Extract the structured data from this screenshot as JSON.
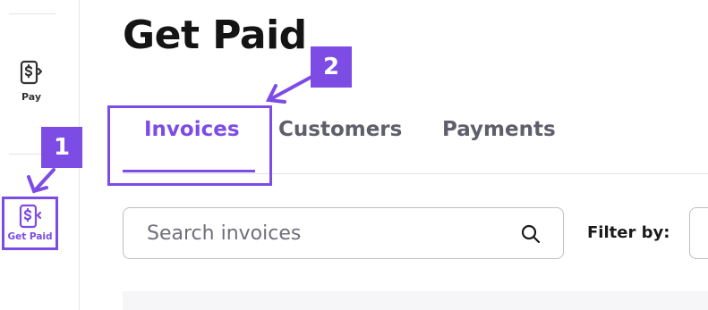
{
  "sidebar": {
    "items": [
      {
        "label": "Pay",
        "icon": "dollar-document-icon",
        "active": false
      },
      {
        "label": "Get Paid",
        "icon": "dollar-document-receive-icon",
        "active": true
      }
    ]
  },
  "page": {
    "title": "Get Paid"
  },
  "tabs": [
    {
      "label": "Invoices",
      "active": true
    },
    {
      "label": "Customers",
      "active": false
    },
    {
      "label": "Payments",
      "active": false
    }
  ],
  "search": {
    "placeholder": "Search invoices",
    "value": ""
  },
  "filter": {
    "label": "Filter by:"
  },
  "annotations": {
    "step_1": "1",
    "step_2": "2"
  },
  "colors": {
    "accent": "#7c4ce5",
    "text": "#1a1a1a",
    "muted": "#5f5f6b",
    "border": "#bdbdc6"
  }
}
